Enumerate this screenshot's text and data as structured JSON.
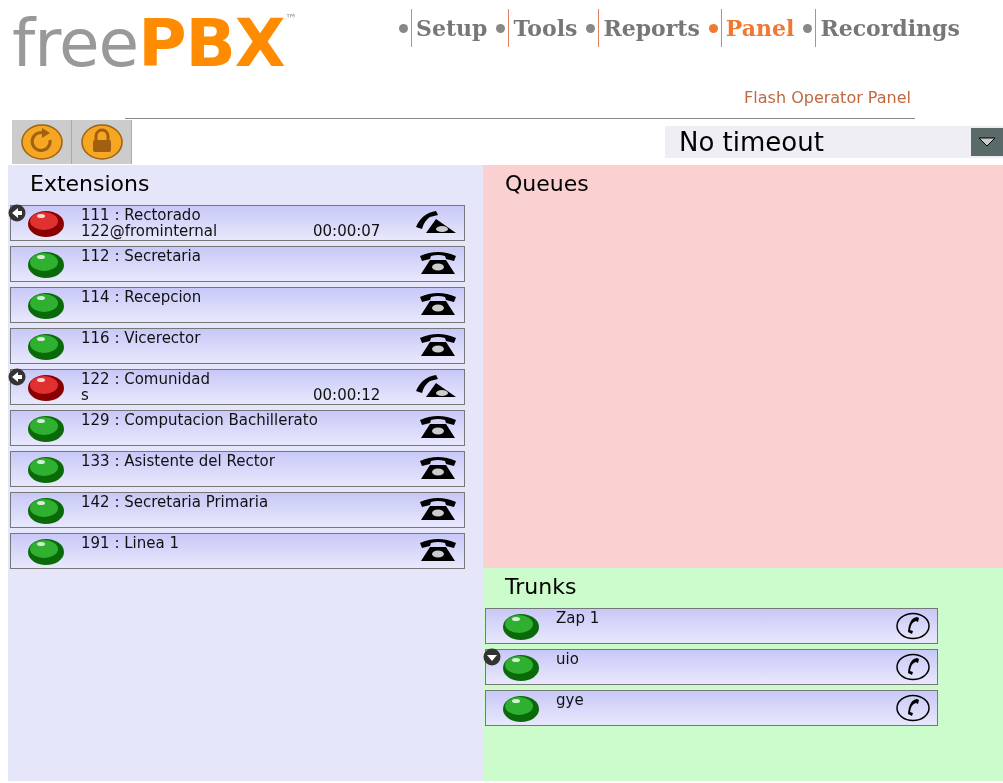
{
  "logo": {
    "part1": "free",
    "part2": "PBX",
    "mark": "™"
  },
  "nav": [
    {
      "label": "Setup",
      "selected": false
    },
    {
      "label": "Tools",
      "selected": false
    },
    {
      "label": "Reports",
      "selected": false
    },
    {
      "label": "Panel",
      "selected": true
    },
    {
      "label": "Recordings",
      "selected": false
    }
  ],
  "subtitle": "Flash Operator Panel",
  "timeout": {
    "value": "No timeout"
  },
  "extensions": {
    "title": "Extensions",
    "items": [
      {
        "label": "111 : Rectorado",
        "detail": "122@frominternal",
        "timer": "00:00:07",
        "busy": true,
        "badge": true
      },
      {
        "label": "112 : Secretaria",
        "busy": false,
        "badge": false
      },
      {
        "label": "114 : Recepcion",
        "busy": false,
        "badge": false
      },
      {
        "label": "116 : Vicerector",
        "busy": false,
        "badge": false
      },
      {
        "label": "122 : Comunidad",
        "detail": "s",
        "timer": "00:00:12",
        "busy": true,
        "badge": true
      },
      {
        "label": "129 : Computacion Bachillerato",
        "busy": false,
        "badge": false
      },
      {
        "label": "133 : Asistente del Rector",
        "busy": false,
        "badge": false
      },
      {
        "label": "142 : Secretaria Primaria",
        "busy": false,
        "badge": false
      },
      {
        "label": "191 : Linea 1",
        "busy": false,
        "badge": false
      }
    ]
  },
  "queues": {
    "title": "Queues"
  },
  "trunks": {
    "title": "Trunks",
    "items": [
      {
        "label": "Zap 1",
        "busy": false,
        "badge": false
      },
      {
        "label": "uio",
        "busy": false,
        "badge": true
      },
      {
        "label": "gye",
        "busy": false,
        "badge": false
      }
    ]
  }
}
